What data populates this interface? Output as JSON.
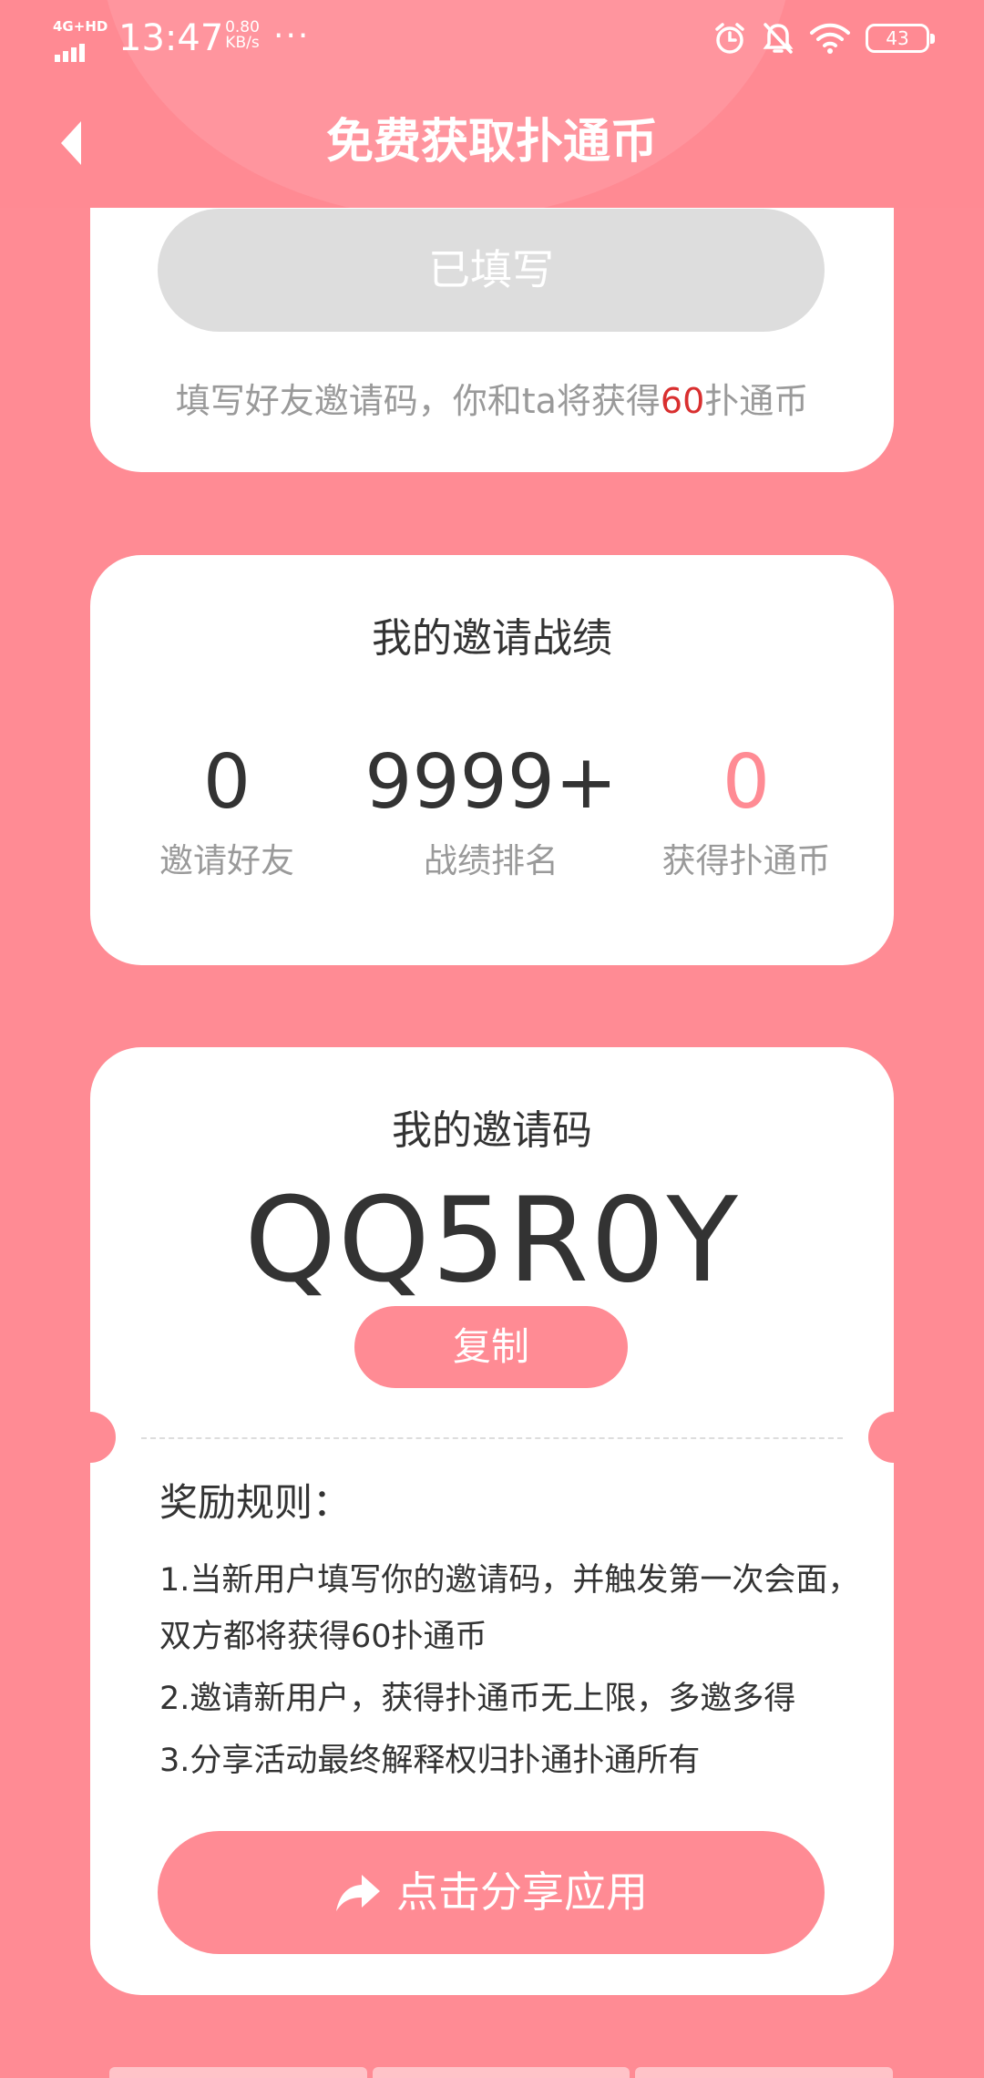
{
  "status_bar": {
    "network": "4G+HD",
    "time": "13:47",
    "speed_value": "0.80",
    "speed_unit": "KB/s",
    "more": "···",
    "battery": "43"
  },
  "header": {
    "title": "免费获取扑通币"
  },
  "invite_entry": {
    "button_label": "已填写",
    "hint_before": "填写好友邀请码，你和ta将获得",
    "hint_amount": "60",
    "hint_after": "扑通币"
  },
  "stats": {
    "title": "我的邀请战绩",
    "items": [
      {
        "value": "0",
        "label": "邀请好友"
      },
      {
        "value": "9999+",
        "label": "战绩排名"
      },
      {
        "value": "0",
        "label": "获得扑通币"
      }
    ]
  },
  "invite_code": {
    "title": "我的邀请码",
    "code": "QQ5R0Y",
    "copy_label": "复制"
  },
  "rules": {
    "title": "奖励规则：",
    "items": [
      "1.当新用户填写你的邀请码，并触发第一次会面，双方都将获得60扑通币",
      "2.邀请新用户，获得扑通币无上限，多邀多得",
      "3.分享活动最终解释权归扑通扑通所有"
    ]
  },
  "share": {
    "label": "点击分享应用"
  },
  "colors": {
    "background": "#ff8b94",
    "accent": "#ff8b94",
    "highlight": "#d92f2f",
    "disabled": "#dddddd"
  }
}
